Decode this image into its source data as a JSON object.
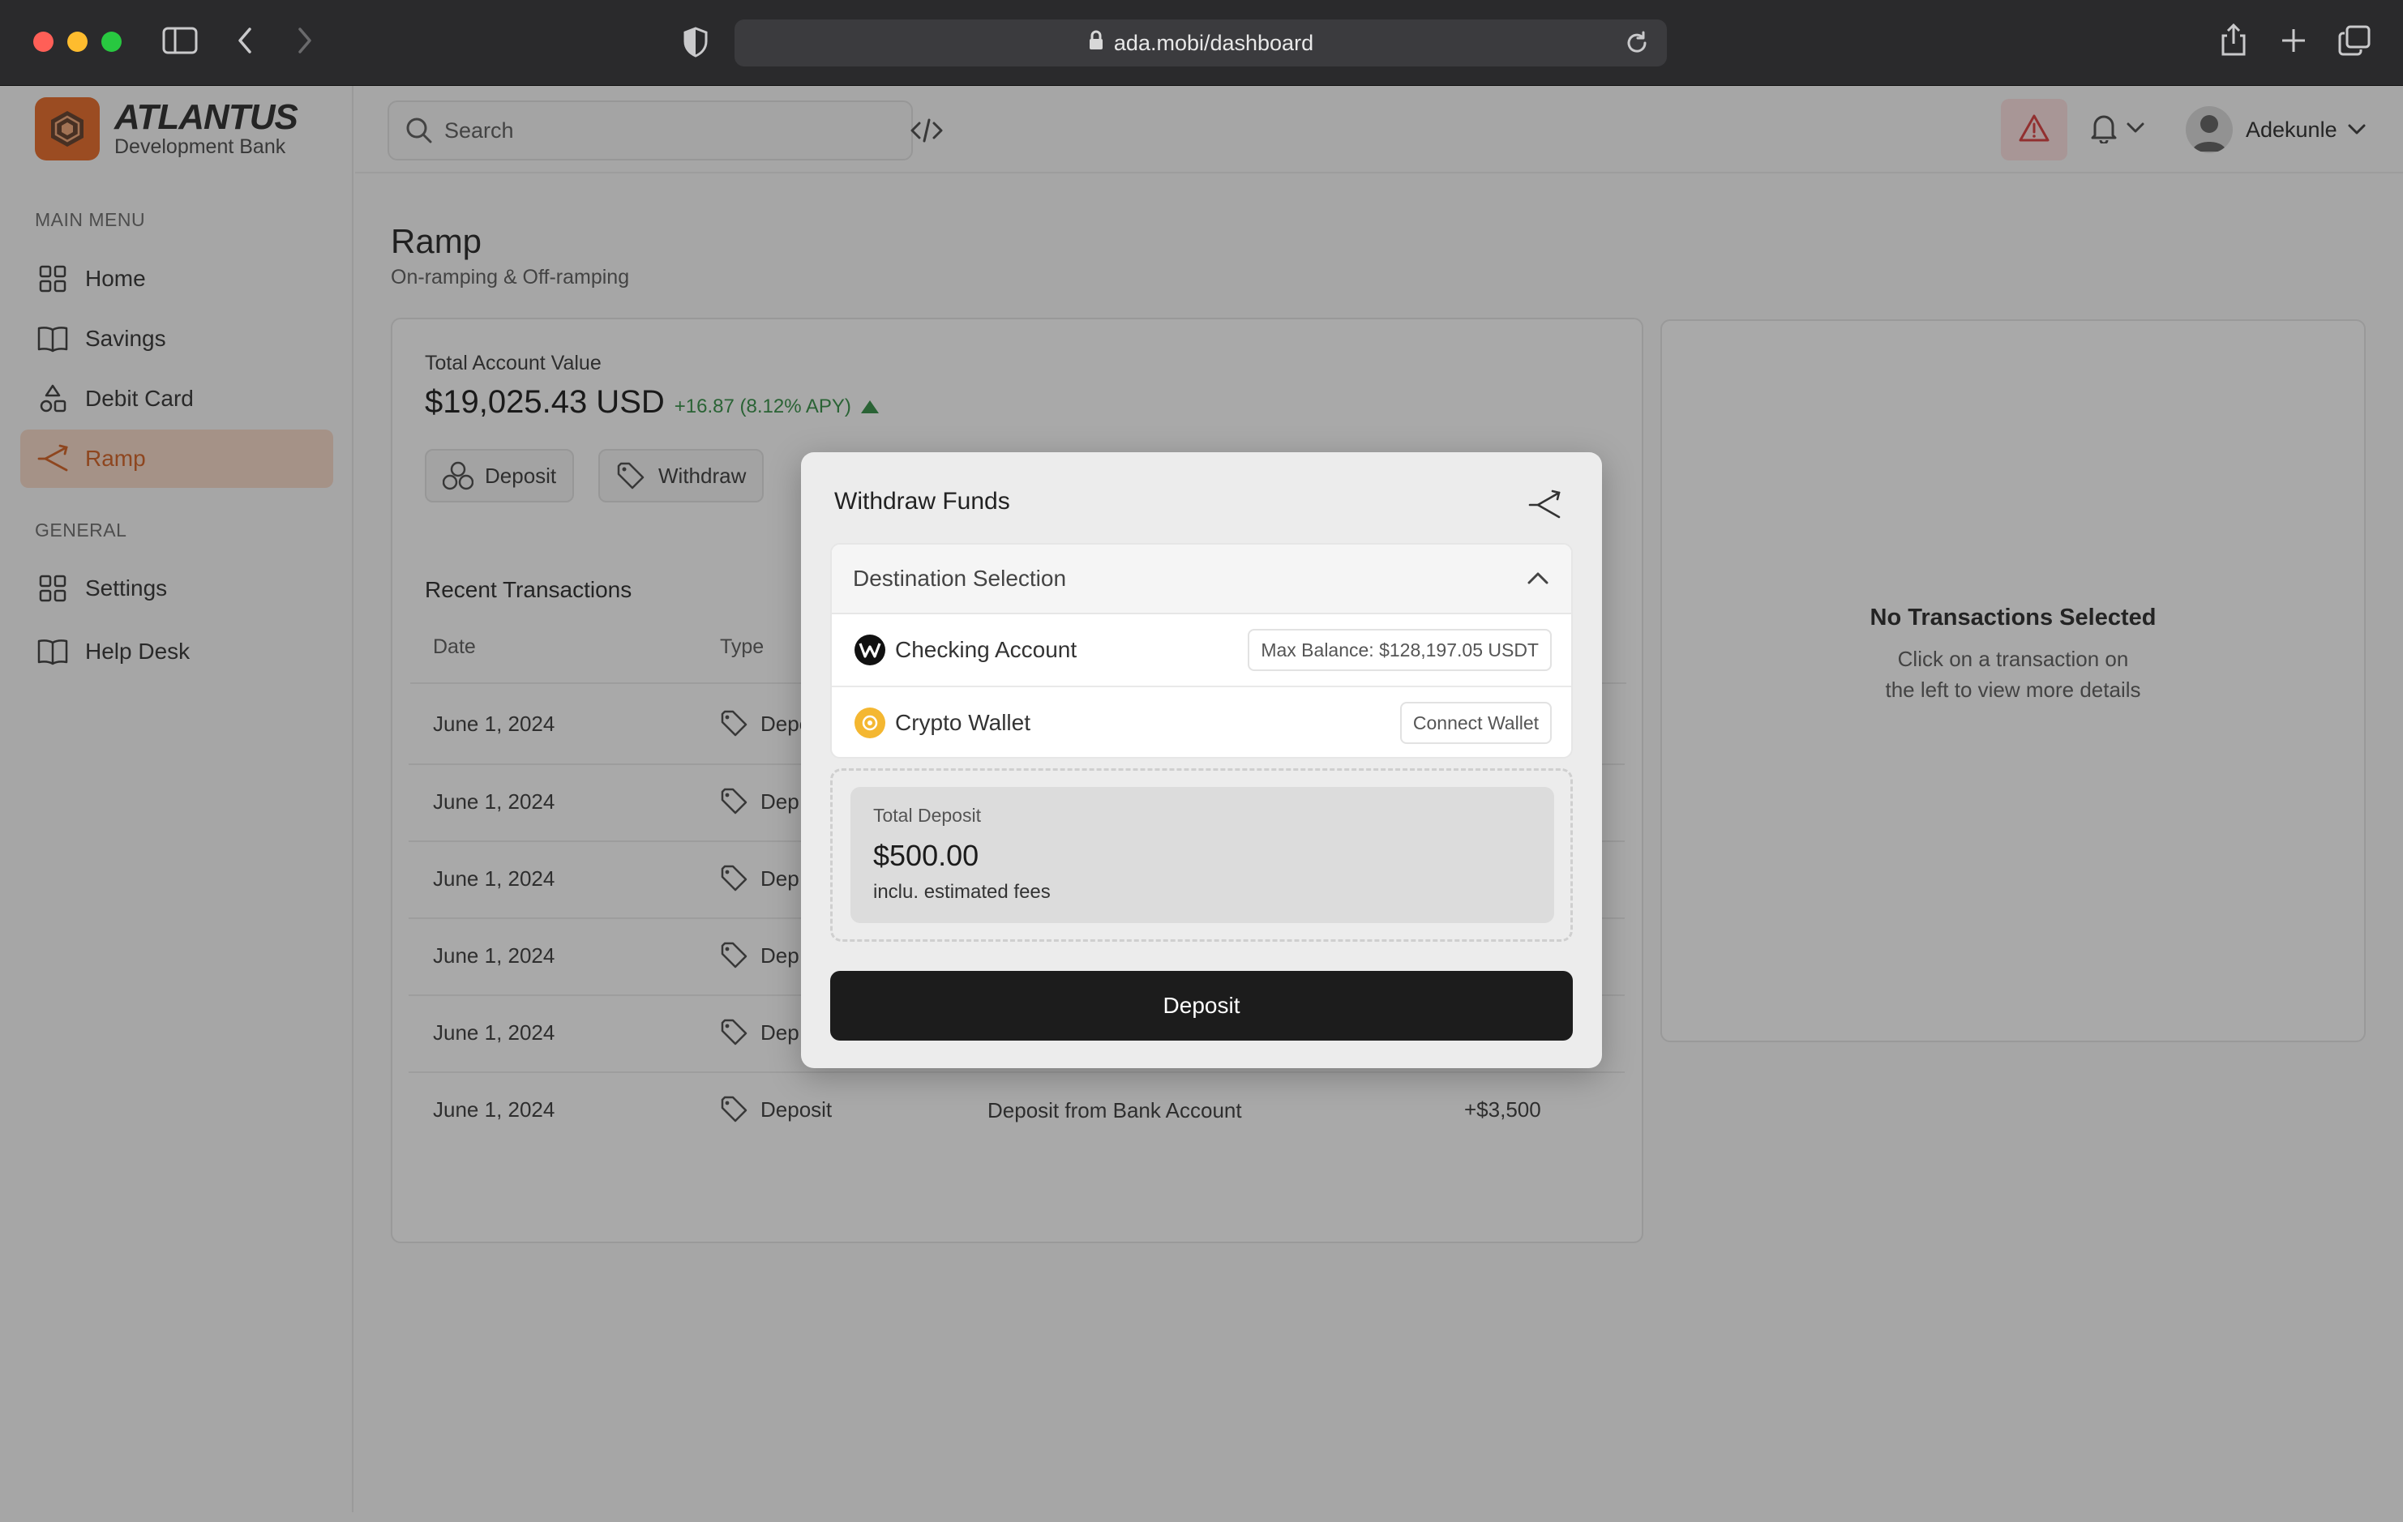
{
  "browser": {
    "url": "ada.mobi/dashboard"
  },
  "brand": {
    "name": "ATLANTUS",
    "subtitle": "Development Bank"
  },
  "sidebar": {
    "main_menu_label": "MAIN MENU",
    "general_label": "GENERAL",
    "items": [
      {
        "label": "Home",
        "icon": "grid-icon"
      },
      {
        "label": "Savings",
        "icon": "book-icon"
      },
      {
        "label": "Debit Card",
        "icon": "shapes-icon"
      },
      {
        "label": "Ramp",
        "icon": "ramp-icon",
        "active": true
      }
    ],
    "general_items": [
      {
        "label": "Settings",
        "icon": "grid-icon"
      },
      {
        "label": "Help Desk",
        "icon": "book-icon"
      }
    ]
  },
  "topbar": {
    "search_placeholder": "Search",
    "user_name": "Adekunle"
  },
  "page": {
    "title": "Ramp",
    "subtitle": "On-ramping & Off-ramping"
  },
  "account": {
    "label": "Total Account Value",
    "value": "$19,025.43 USD",
    "change": "+16.87 (8.12% APY)",
    "deposit_label": "Deposit",
    "withdraw_label": "Withdraw"
  },
  "transactions": {
    "title": "Recent Transactions",
    "headers": {
      "date": "Date",
      "type": "Type"
    },
    "rows": [
      {
        "date": "June 1, 2024",
        "type": "Depo"
      },
      {
        "date": "June 1, 2024",
        "type": "Dep"
      },
      {
        "date": "June 1, 2024",
        "type": "Dep"
      },
      {
        "date": "June 1, 2024",
        "type": "Dep"
      },
      {
        "date": "June 1, 2024",
        "type": "Dep"
      },
      {
        "date": "June 1, 2024",
        "type": "Deposit",
        "description": "Deposit from Bank Account",
        "amount": "+$3,500"
      }
    ]
  },
  "side_panel": {
    "title": "No Transactions Selected",
    "line1": "Click on a transaction on",
    "line2": "the left to view more details"
  },
  "modal": {
    "title": "Withdraw Funds",
    "destination_header": "Destination Selection",
    "options": [
      {
        "label": "Checking Account",
        "badge": "Max Balance: $128,197.05 USDT",
        "icon": "w-coin-icon"
      },
      {
        "label": "Crypto Wallet",
        "badge": "Connect Wallet",
        "icon": "wallet-coin-icon"
      }
    ],
    "total_label": "Total Deposit",
    "total_value": "$500.00",
    "total_note": "inclu. estimated fees",
    "submit_label": "Deposit"
  },
  "colors": {
    "accent": "#e8641e",
    "active_bg": "#f8d9c7",
    "positive": "#2c8a3e",
    "alert_bg": "#fde0e0"
  }
}
